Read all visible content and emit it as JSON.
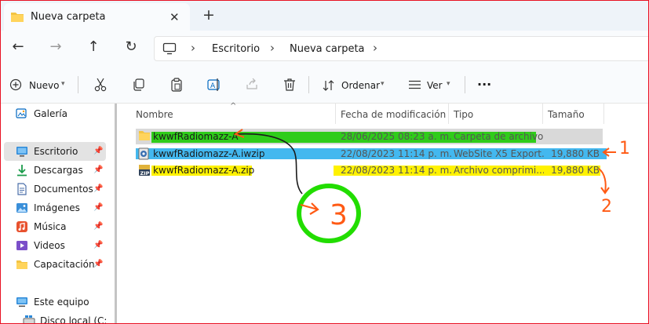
{
  "window": {
    "tab_title": "Nueva carpeta",
    "new_tab": "+",
    "close_tab": "✕"
  },
  "nav": {
    "back": "←",
    "forward": "→",
    "up": "↑",
    "refresh": "↻",
    "breadcrumbs": [
      "Escritorio",
      "Nueva carpeta"
    ],
    "separator": "›"
  },
  "toolbar": {
    "new_label": "Nuevo",
    "sort_label": "Ordenar",
    "view_label": "Ver",
    "more_label": "···"
  },
  "sidebar": {
    "items": [
      {
        "label": "Galería",
        "icon": "gallery-icon",
        "pinned": false
      },
      {
        "label": "Escritorio",
        "icon": "desktop-icon",
        "pinned": true,
        "active": true
      },
      {
        "label": "Descargas",
        "icon": "downloads-icon",
        "pinned": true
      },
      {
        "label": "Documentos",
        "icon": "documents-icon",
        "pinned": true
      },
      {
        "label": "Imágenes",
        "icon": "pictures-icon",
        "pinned": true
      },
      {
        "label": "Música",
        "icon": "music-icon",
        "pinned": true
      },
      {
        "label": "Videos",
        "icon": "videos-icon",
        "pinned": true
      },
      {
        "label": "Capacitación F",
        "icon": "folder-icon",
        "pinned": true
      },
      {
        "label": "Este equipo",
        "icon": "computer-icon",
        "pinned": false
      },
      {
        "label": "Disco local (C:)",
        "icon": "drive-icon",
        "pinned": false
      }
    ]
  },
  "table": {
    "columns": [
      "Nombre",
      "Fecha de modificación",
      "Tipo",
      "Tamaño"
    ],
    "rows": [
      {
        "name": "kwwfRadiomazz-A",
        "date": "28/06/2025 08:23 a. m.",
        "type": "Carpeta de archivos",
        "size": "",
        "icon": "folder-icon",
        "highlight": "#2fcc1a"
      },
      {
        "name": "kwwfRadiomazz-A.iwzip",
        "date": "22/08/2023 11:14 p. m.",
        "type": "WebSite X5 Export...",
        "size": "19,880 KB",
        "icon": "iwzip-file-icon",
        "highlight": "#43b8ef"
      },
      {
        "name": "kwwfRadiomazz-A.zip",
        "date": "22/08/2023 11:14 p. m.",
        "type": "Archivo comprimi...",
        "size": "19,880 KB",
        "icon": "zip-file-icon",
        "highlight": "#fff200"
      }
    ]
  },
  "annotations": {
    "marks": [
      "1",
      "2",
      "3"
    ],
    "arrow_color": "#ff5a14",
    "circle_color": "#22dd00"
  },
  "colors": {
    "accent": "#0067c0",
    "window_border": "#e81123",
    "tab_bar": "#eef3f9",
    "selected_row": "#d9d9d9"
  }
}
